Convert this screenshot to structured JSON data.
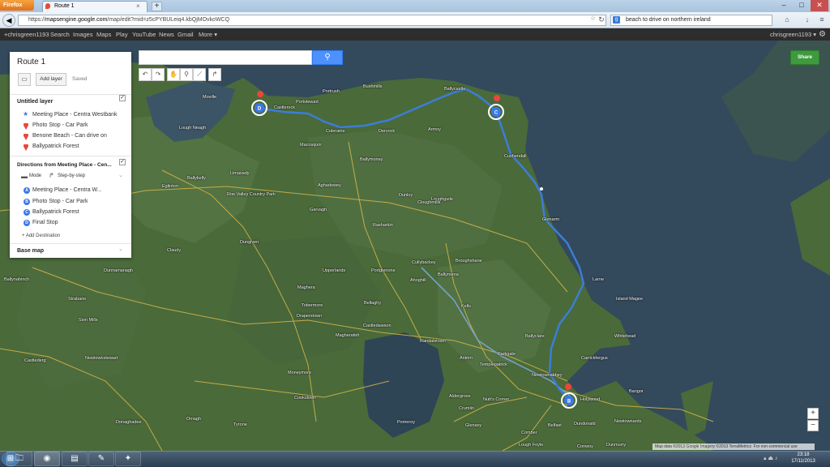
{
  "browser": {
    "menu_button": "Firefox",
    "tab_title": "Route 1",
    "new_tab": "+",
    "url_prefix": "https://",
    "url_host": "mapsengine.google.com",
    "url_rest": "/map/edit?mid=z5cPYBULeiq4.kbQjMOvkoWCQ",
    "search_text": "beach to drive on northern ireland",
    "window_controls": [
      "–",
      "□",
      "✕"
    ]
  },
  "google_bar": {
    "links": [
      "+chrisgreen1193",
      "Search",
      "Images",
      "Maps",
      "Play",
      "YouTube",
      "News",
      "Gmail",
      "More"
    ],
    "more_arrow": "▾",
    "user": "chrisgreen1193 ▾"
  },
  "panel": {
    "title": "Route 1",
    "add_layer": "Add layer",
    "status": "Saved",
    "layer1": {
      "title": "Untitled layer",
      "items": [
        {
          "label": "Meeting Place - Centra Westbank",
          "icon": "star-icon"
        },
        {
          "label": "Photo Stop - Car Park",
          "icon": "pin-icon"
        },
        {
          "label": "Benone Beach - Can drive on",
          "icon": "pin-icon"
        },
        {
          "label": "Ballypatrick Forest",
          "icon": "pin-icon"
        }
      ]
    },
    "directions": {
      "title": "Directions from Meeting Place - Cen...",
      "mode": "Mode",
      "step_by_step": "Step-by-step",
      "stops": [
        {
          "letter": "A",
          "label": "Meeting Place - Centra W..."
        },
        {
          "letter": "B",
          "label": "Photo Stop - Car Park"
        },
        {
          "letter": "C",
          "label": "Ballypatrick Forest"
        },
        {
          "letter": "D",
          "label": "Final Stop"
        }
      ],
      "add_destination": "+ Add Destination"
    },
    "base_map": "Base map"
  },
  "map": {
    "share": "Share",
    "zoom_in": "+",
    "zoom_out": "−",
    "attribution": "Map data ©2013 Google Imagery ©2013 TerraMetrics",
    "terms": "For non-commercial use",
    "places": [
      {
        "name": "Moville"
      },
      {
        "name": "Castlerock"
      },
      {
        "name": "Portstewart"
      },
      {
        "name": "Portrush"
      },
      {
        "name": "Bushmills"
      },
      {
        "name": "Ballycastle"
      },
      {
        "name": "Coleraine"
      },
      {
        "name": "Dervock"
      },
      {
        "name": "Armoy"
      },
      {
        "name": "Macosquin"
      },
      {
        "name": "Cushendall"
      },
      {
        "name": "Ballymoney"
      },
      {
        "name": "Limavady"
      },
      {
        "name": "Ballykelly"
      },
      {
        "name": "Eglinton"
      },
      {
        "name": "Aghadowey"
      },
      {
        "name": "Roe Valley Country Park"
      },
      {
        "name": "Dunloy"
      },
      {
        "name": "Loughguile"
      },
      {
        "name": "Cloughmills"
      },
      {
        "name": "Garvagh"
      },
      {
        "name": "Rasharkin"
      },
      {
        "name": "Glenarm"
      },
      {
        "name": "Dungiven"
      },
      {
        "name": "Claudy"
      },
      {
        "name": "Cullybackey"
      },
      {
        "name": "Broughshane"
      },
      {
        "name": "Upperlands"
      },
      {
        "name": "Portglenone"
      },
      {
        "name": "Ahoghill"
      },
      {
        "name": "Ballymena"
      },
      {
        "name": "Dunnamanagh"
      },
      {
        "name": "Maghera"
      },
      {
        "name": "Larne"
      },
      {
        "name": "Tobermore"
      },
      {
        "name": "Draperstown"
      },
      {
        "name": "Bellaghy"
      },
      {
        "name": "Kells"
      },
      {
        "name": "Island Magee"
      },
      {
        "name": "Strabane"
      },
      {
        "name": "Castledawson"
      },
      {
        "name": "Magherafelt"
      },
      {
        "name": "Ballyclare"
      },
      {
        "name": "Whitehead"
      },
      {
        "name": "Randalstown"
      },
      {
        "name": "Sion Mills"
      },
      {
        "name": "Antrim"
      },
      {
        "name": "Parkgate"
      },
      {
        "name": "Carrickfergus"
      },
      {
        "name": "Templepatrick"
      },
      {
        "name": "Castlederg"
      },
      {
        "name": "Newtownstewart"
      },
      {
        "name": "Newtownabbey"
      },
      {
        "name": "Moneymore"
      },
      {
        "name": "Holywood"
      },
      {
        "name": "Bangor"
      },
      {
        "name": "Crumlin"
      },
      {
        "name": "Aldergrove"
      },
      {
        "name": "Nutt's Corner"
      },
      {
        "name": "Cookstown"
      },
      {
        "name": "Glenavy"
      },
      {
        "name": "Belfast"
      },
      {
        "name": "Dundonald"
      },
      {
        "name": "Newtownards"
      },
      {
        "name": "Donaghadee"
      },
      {
        "name": "Omagh"
      },
      {
        "name": "Tyrone"
      },
      {
        "name": "Pomeroy"
      },
      {
        "name": "Lough Neagh"
      },
      {
        "name": "Lough Foyle"
      },
      {
        "name": "Dunmurry"
      },
      {
        "name": "Comber"
      },
      {
        "name": "Andersonstown"
      },
      {
        "name": "Ballynahinch"
      },
      {
        "name": "Conwoy"
      },
      {
        "name": "Lisburn"
      }
    ],
    "route_markers": [
      "D",
      "C",
      "B"
    ]
  },
  "taskbar": {
    "time": "23:18",
    "date": "17/11/2013"
  }
}
